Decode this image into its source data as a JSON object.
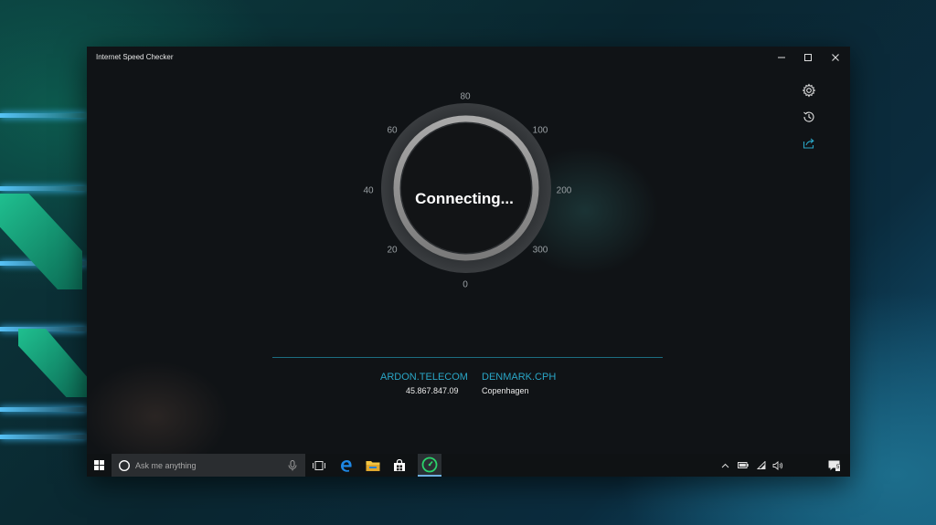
{
  "window": {
    "title": "Internet Speed Checker",
    "controls": [
      "minimize",
      "maximize",
      "close"
    ]
  },
  "side_actions": [
    {
      "name": "settings",
      "icon": "gear-icon"
    },
    {
      "name": "history",
      "icon": "history-icon"
    },
    {
      "name": "share",
      "icon": "share-icon",
      "color": "#2aa6c6"
    }
  ],
  "gauge": {
    "status": "Connecting...",
    "scale_labels": [
      "0",
      "20",
      "40",
      "60",
      "80",
      "100",
      "200",
      "300"
    ]
  },
  "server_info": {
    "isp_name": "ARDON.TELECOM",
    "ip_address": "45.867.847.09",
    "server_name": "DENMARK.CPH",
    "server_city": "Copenhagen"
  },
  "taskbar": {
    "search_placeholder": "Ask me anything",
    "notification_count": "5",
    "pinned": [
      "task-view-icon",
      "edge-icon",
      "file-explorer-icon",
      "store-icon",
      "speed-checker-icon"
    ],
    "tray": [
      "chevron-up-icon",
      "battery-icon",
      "wifi-icon",
      "volume-icon",
      "action-center-icon"
    ]
  },
  "colors": {
    "accent": "#2aa6c6",
    "active_app": "#2bd36b",
    "window_bg": "#101316"
  }
}
